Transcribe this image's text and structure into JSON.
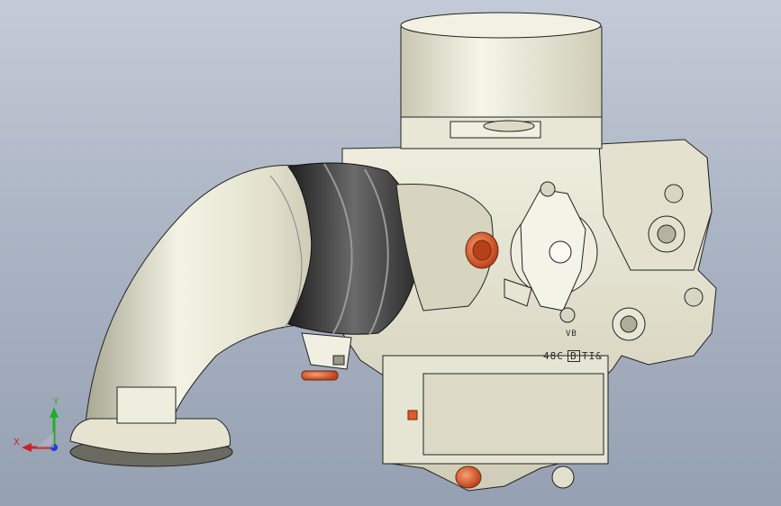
{
  "viewport": {
    "background_top": "#c4cbd8",
    "background_bottom": "#95a0b2"
  },
  "model": {
    "part_description_icon": "carburetor-assembly-icon",
    "engravings": {
      "code": "48C",
      "boxed": "B",
      "suffix": "TI&",
      "small": "VB"
    },
    "colors": {
      "body": "#e8e6d4",
      "body_shade": "#c8c6b0",
      "rubber": "#3a3a3a",
      "accent_orange": "#e05a2a",
      "edge": "#222222"
    }
  },
  "triad": {
    "x_label": "X",
    "y_label": "Y",
    "x_color": "#d22020",
    "y_color": "#20b020",
    "z_color": "#2040d0"
  }
}
